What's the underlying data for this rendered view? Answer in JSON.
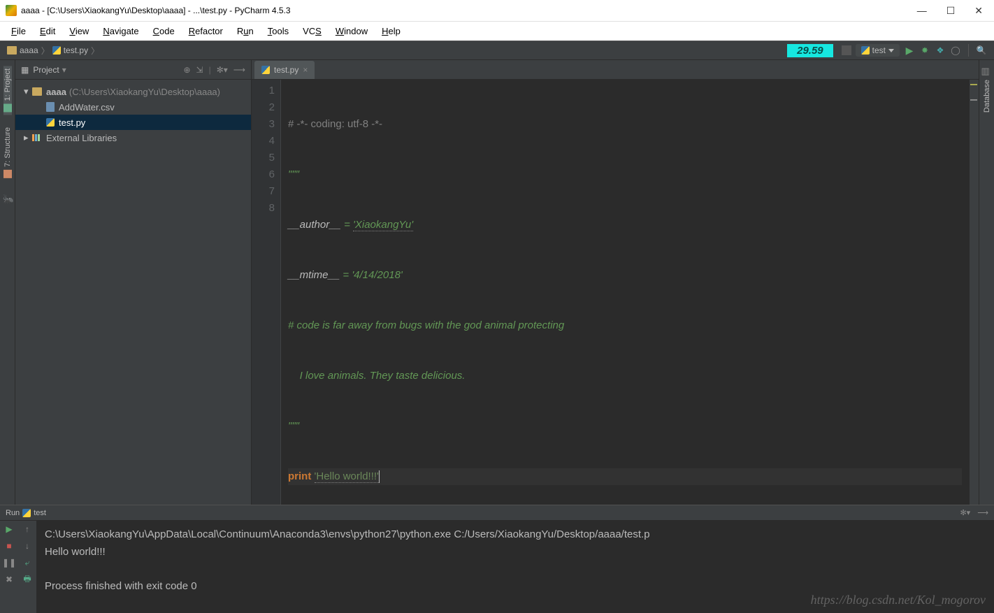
{
  "window": {
    "title": "aaaa - [C:\\Users\\XiaokangYu\\Desktop\\aaaa] - ...\\test.py - PyCharm 4.5.3"
  },
  "menu": {
    "items": [
      "File",
      "Edit",
      "View",
      "Navigate",
      "Code",
      "Refactor",
      "Run",
      "Tools",
      "VCS",
      "Window",
      "Help"
    ]
  },
  "breadcrumb": {
    "root": "aaaa",
    "file": "test.py"
  },
  "toolbar": {
    "time": "29.59",
    "runconfig": "test"
  },
  "left_tools": {
    "project": "1: Project",
    "structure": "7: Structure"
  },
  "right_tools": {
    "database": "Database"
  },
  "project_panel": {
    "label": "Project",
    "root_name": "aaaa",
    "root_path": "(C:\\Users\\XiaokangYu\\Desktop\\aaaa)",
    "files": [
      "AddWater.csv",
      "test.py"
    ],
    "ext_libs": "External Libraries"
  },
  "editor": {
    "tab": "test.py",
    "lines": [
      "1",
      "2",
      "3",
      "4",
      "5",
      "6",
      "7",
      "8"
    ],
    "l1": "# -*- coding: utf-8 -*-",
    "l2": "\"\"\"",
    "l3_a": "__author__",
    "l3_b": " = ",
    "l3_c": "'XiaokangYu'",
    "l4_a": "__mtime__",
    "l4_b": " = ",
    "l4_c": "'4/14/2018'",
    "l5": "# code is far away from bugs with the god animal protecting",
    "l6": "    I love animals. They taste delicious.",
    "l7": "\"\"\"",
    "l8_kw": "print",
    "l8_sp": " ",
    "l8_str": "'Hello world!!!'"
  },
  "run": {
    "tab_label": "Run",
    "tab_name": "test",
    "cmd": "C:\\Users\\XiaokangYu\\AppData\\Local\\Continuum\\Anaconda3\\envs\\python27\\python.exe C:/Users/XiaokangYu/Desktop/aaaa/test.p",
    "out": "Hello world!!!",
    "exit": "Process finished with exit code 0"
  },
  "watermark": "https://blog.csdn.net/Kol_mogorov"
}
